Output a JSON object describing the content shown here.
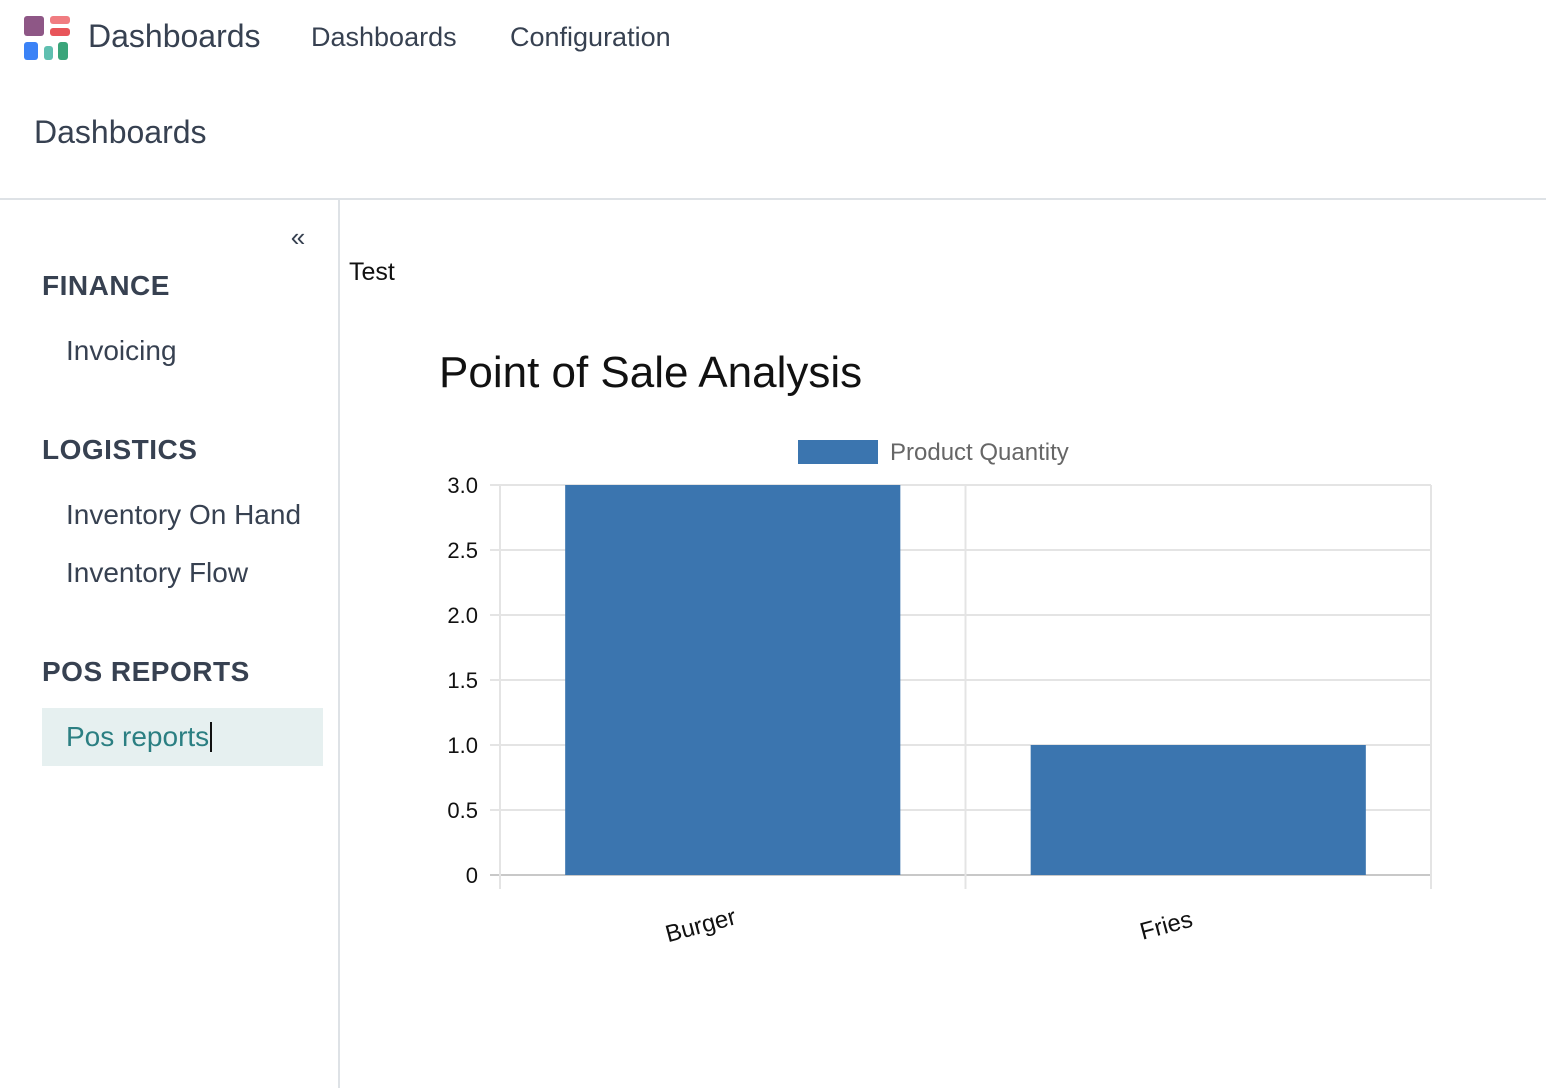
{
  "navbar": {
    "app_name": "Dashboards",
    "menu": [
      {
        "label": "Dashboards"
      },
      {
        "label": "Configuration"
      }
    ],
    "logo_colors": [
      "#8e5786",
      "#f07c81",
      "#e8555a",
      "#3b82f6",
      "#5fbfb0",
      "#3aa57a"
    ]
  },
  "control_panel": {
    "title": "Dashboards"
  },
  "sidebar": {
    "collapse_icon": "double-chevron-left-icon",
    "sections": [
      {
        "title": "FINANCE",
        "items": [
          {
            "label": "Invoicing"
          }
        ]
      },
      {
        "title": "LOGISTICS",
        "items": [
          {
            "label": "Inventory On Hand"
          },
          {
            "label": "Inventory Flow"
          }
        ]
      },
      {
        "title": "POS REPORTS",
        "items": [
          {
            "label": "Pos reports",
            "active": true
          }
        ]
      }
    ]
  },
  "main": {
    "dashboard_name": "Test"
  },
  "chart_data": {
    "type": "bar",
    "title": "Point of Sale Analysis",
    "categories": [
      "Burger",
      "Fries"
    ],
    "series": [
      {
        "name": "Product Quantity",
        "values": [
          3,
          1
        ],
        "color": "#3b75af"
      }
    ],
    "ylim": [
      0,
      3
    ],
    "y_ticks": [
      "0",
      "0.5",
      "1.0",
      "1.5",
      "2.0",
      "2.5",
      "3.0"
    ],
    "grid": true,
    "legend": "top"
  }
}
